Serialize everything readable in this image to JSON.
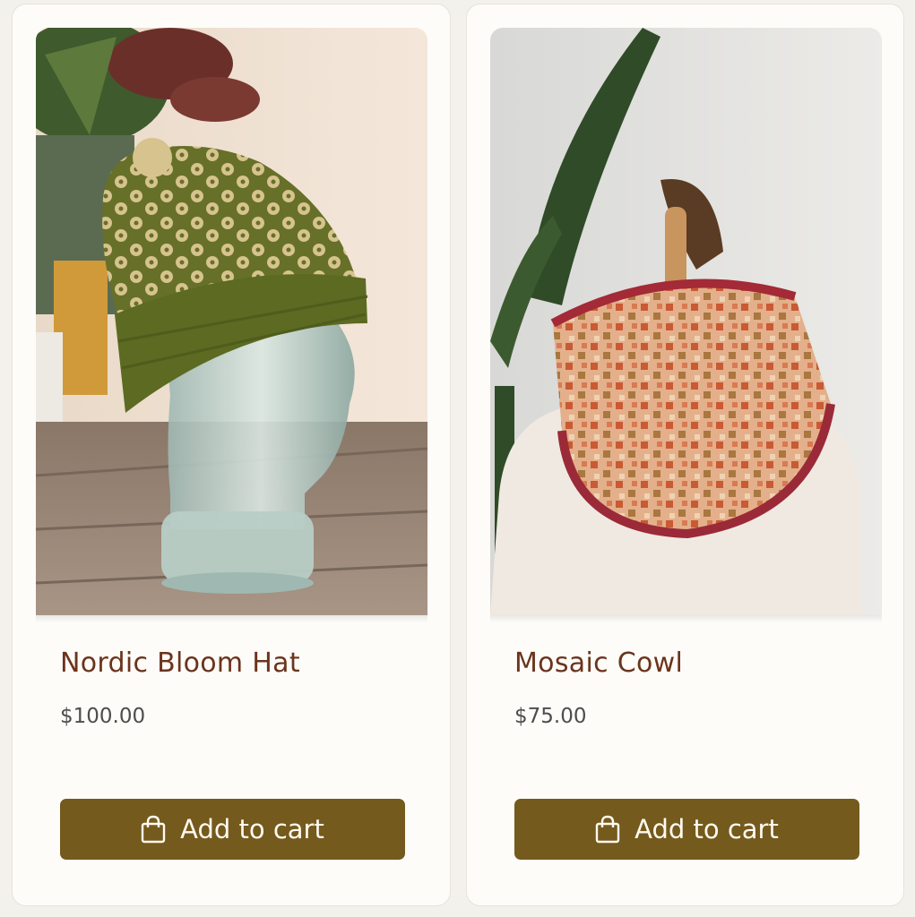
{
  "products": [
    {
      "name": "Nordic Bloom Hat",
      "price": "$100.00",
      "button_label": "Add to cart",
      "image_subject": "green and cream colorwork beanie on glass head"
    },
    {
      "name": "Mosaic Cowl",
      "price": "$75.00",
      "button_label": "Add to cart",
      "image_subject": "red and orange mosaic-knit cowl on dress form"
    }
  ],
  "colors": {
    "title": "#6b341c",
    "price": "#4d4d4d",
    "button_bg": "#755a1d",
    "button_text": "#fffaf0",
    "card_bg": "#fdfcf9"
  },
  "icons": {
    "button_icon": "shopping-bag-icon"
  }
}
